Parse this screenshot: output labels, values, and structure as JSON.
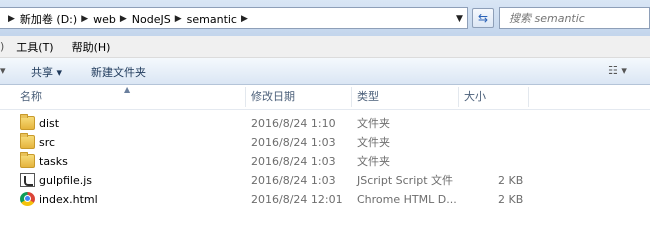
{
  "address": {
    "crumbs": [
      "新加卷 (D:)",
      "web",
      "NodeJS",
      "semantic"
    ],
    "search_placeholder": "搜索 semantic"
  },
  "menu": [
    "工具(T)",
    "帮助(H)"
  ],
  "toolbar": {
    "share_label": "共享 ▾",
    "new_folder_label": "新建文件夹"
  },
  "columns": {
    "name": "名称",
    "modified": "修改日期",
    "type": "类型",
    "size": "大小"
  },
  "files": [
    {
      "name": "dist",
      "modified": "2016/8/24 1:10",
      "type": "文件夹",
      "size": "",
      "icon": "folder-icon"
    },
    {
      "name": "src",
      "modified": "2016/8/24 1:03",
      "type": "文件夹",
      "size": "",
      "icon": "folder-icon"
    },
    {
      "name": "tasks",
      "modified": "2016/8/24 1:03",
      "type": "文件夹",
      "size": "",
      "icon": "folder-icon"
    },
    {
      "name": "gulpfile.js",
      "modified": "2016/8/24 1:03",
      "type": "JScript Script 文件",
      "size": "2 KB",
      "icon": "jscript-file-icon"
    },
    {
      "name": "index.html",
      "modified": "2016/8/24 12:01",
      "type": "Chrome HTML D...",
      "size": "2 KB",
      "icon": "chrome-html-icon"
    }
  ]
}
